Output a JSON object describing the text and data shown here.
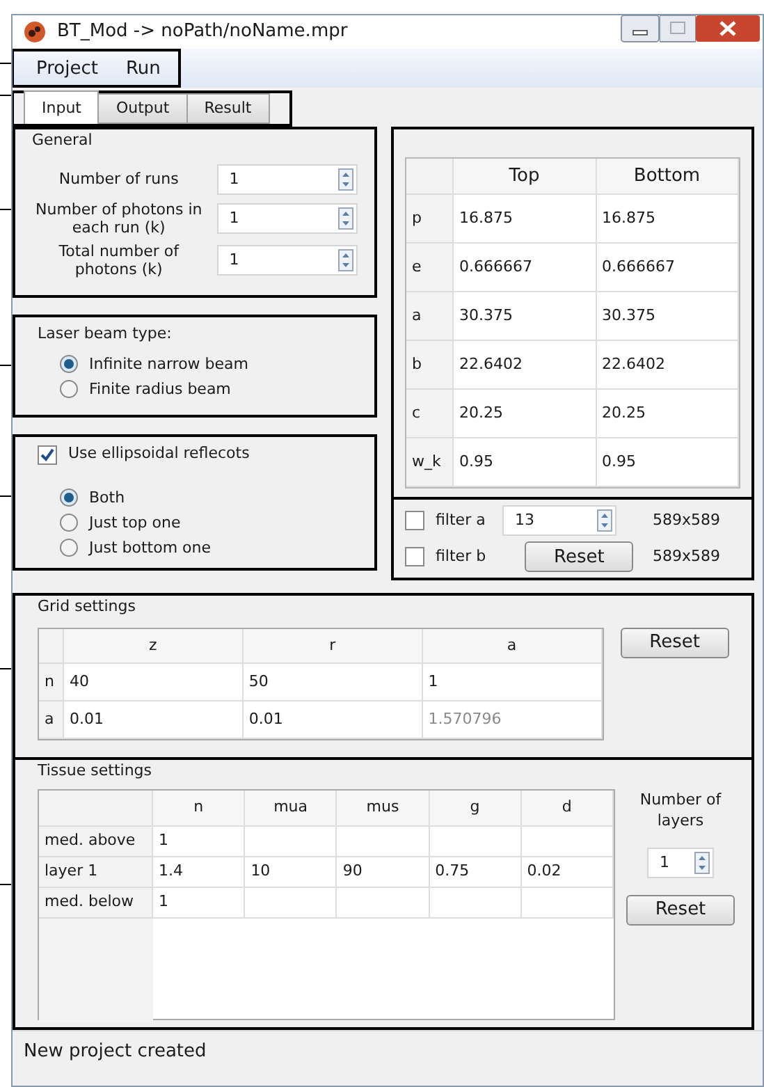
{
  "window": {
    "title": "BT_Mod -> noPath/noName.mpr"
  },
  "menu": [
    {
      "label": "Project"
    },
    {
      "label": "Run"
    }
  ],
  "tabs": [
    {
      "label": "Input",
      "selected": true
    },
    {
      "label": "Output",
      "selected": false
    },
    {
      "label": "Result",
      "selected": false
    }
  ],
  "general": {
    "title": "General",
    "fields": [
      {
        "label": "Number of runs",
        "value": "1"
      },
      {
        "label": "Number of photons in each run (k)",
        "value": "1"
      },
      {
        "label": "Total number of photons (k)",
        "value": "1"
      }
    ]
  },
  "laser": {
    "title": "Laser beam type:",
    "options": [
      {
        "label": "Infinite narrow beam",
        "selected": true
      },
      {
        "label": "Finite radius beam",
        "selected": false
      }
    ]
  },
  "reflectors": {
    "label": "Use ellipsoidal reflecots",
    "checked": true,
    "options": [
      {
        "label": "Both",
        "selected": true
      },
      {
        "label": "Just top one",
        "selected": false
      },
      {
        "label": "Just bottom one",
        "selected": false
      }
    ]
  },
  "ellipse_table": {
    "columns": [
      "Top",
      "Bottom"
    ],
    "rows": [
      {
        "header": "p",
        "cells": [
          "16.875",
          "16.875"
        ]
      },
      {
        "header": "e",
        "cells": [
          "0.666667",
          "0.666667"
        ]
      },
      {
        "header": "a",
        "cells": [
          "30.375",
          "30.375"
        ]
      },
      {
        "header": "b",
        "cells": [
          "22.6402",
          "22.6402"
        ]
      },
      {
        "header": "c",
        "cells": [
          "20.25",
          "20.25"
        ]
      },
      {
        "header": "w_k",
        "cells": [
          "0.95",
          "0.95"
        ]
      }
    ]
  },
  "filters": {
    "items": [
      {
        "label": "filter a",
        "checked": false,
        "size": "589x589"
      },
      {
        "label": "filter b",
        "checked": false,
        "size": "589x589"
      }
    ],
    "value": "13",
    "button": "Reset"
  },
  "grid": {
    "title": "Grid settings",
    "columns": [
      "z",
      "r",
      "a"
    ],
    "rows": [
      {
        "header": "n",
        "cells": [
          {
            "value": "40",
            "disabled": false
          },
          {
            "value": "50",
            "disabled": false
          },
          {
            "value": "1",
            "disabled": false
          }
        ]
      },
      {
        "header": "a",
        "cells": [
          {
            "value": "0.01",
            "disabled": false
          },
          {
            "value": "0.01",
            "disabled": false
          },
          {
            "value": "1.570796",
            "disabled": true
          }
        ]
      }
    ],
    "button": "Reset"
  },
  "tissue": {
    "title": "Tissue settings",
    "columns": [
      "n",
      "mua",
      "mus",
      "g",
      "d"
    ],
    "rows": [
      {
        "header": "med. above",
        "cells": [
          "1",
          "",
          "",
          "",
          ""
        ]
      },
      {
        "header": "layer 1",
        "cells": [
          "1.4",
          "10",
          "90",
          "0.75",
          "0.02"
        ]
      },
      {
        "header": "med. below",
        "cells": [
          "1",
          "",
          "",
          "",
          ""
        ]
      }
    ],
    "layers_label": "Number of layers",
    "layers_value": "1",
    "button": "Reset"
  },
  "status_bar": "New project created"
}
